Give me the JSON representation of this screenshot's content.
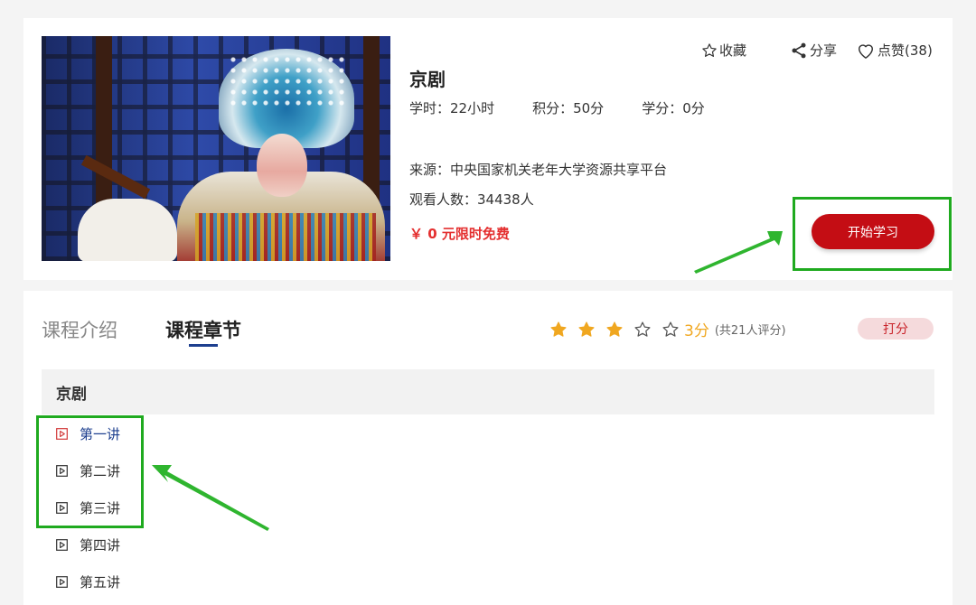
{
  "course": {
    "title": "京剧",
    "hours": "学时：22小时",
    "points": "积分：50分",
    "credits": "学分：0分",
    "source": "来源：中央国家机关老年大学资源共享平台",
    "viewers": "观看人数：34438人",
    "price": "￥ 0 元限时免费"
  },
  "actions": {
    "favorite": "收藏",
    "share": "分享",
    "like": "点赞(38)"
  },
  "start_button": "开始学习",
  "tabs": {
    "intro": "课程介绍",
    "chapters": "课程章节"
  },
  "rating": {
    "filled_stars": 3,
    "total_stars": 5,
    "score": "3分",
    "count": "(共21人评分)",
    "rate_button": "打分"
  },
  "section": {
    "title": "京剧",
    "lectures": [
      {
        "label": "第一讲",
        "active": true
      },
      {
        "label": "第二讲",
        "active": false
      },
      {
        "label": "第三讲",
        "active": false
      },
      {
        "label": "第四讲",
        "active": false
      },
      {
        "label": "第五讲",
        "active": false
      }
    ]
  },
  "colors": {
    "accent_red": "#c40d14",
    "price_red": "#e42f2f",
    "star_gold": "#f0a720",
    "tab_underline": "#1d3f8f",
    "annotation_green": "#1faa1f"
  }
}
